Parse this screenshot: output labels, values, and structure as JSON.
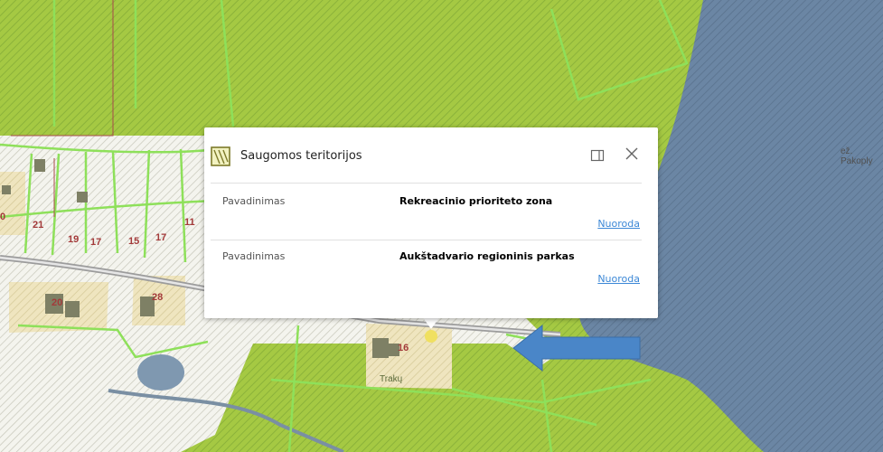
{
  "map": {
    "lake_label_line1": "ež.",
    "lake_label_line2": "Pakoply",
    "parcel_numbers": [
      "21",
      "19",
      "17",
      "15",
      "17",
      "11",
      "20",
      "28",
      "16",
      "0"
    ],
    "place_label": "Trakų",
    "colors": {
      "green_zone": "#a5c943",
      "green_hatch": "#8bb23a",
      "lake": "#6b86a4",
      "lake_hatch": "#58718c",
      "arrow": "#4a86c8",
      "parcel": "#f1e7c2",
      "boundary": "#8ee05a"
    }
  },
  "popup": {
    "title": "Saugomos teritorijos",
    "rows": [
      {
        "label": "Pavadinimas",
        "value": "Rekreacinio prioriteto zona",
        "link": "Nuoroda"
      },
      {
        "label": "Pavadinimas",
        "value": "Aukštadvario regioninis parkas",
        "link": "Nuoroda"
      }
    ]
  }
}
